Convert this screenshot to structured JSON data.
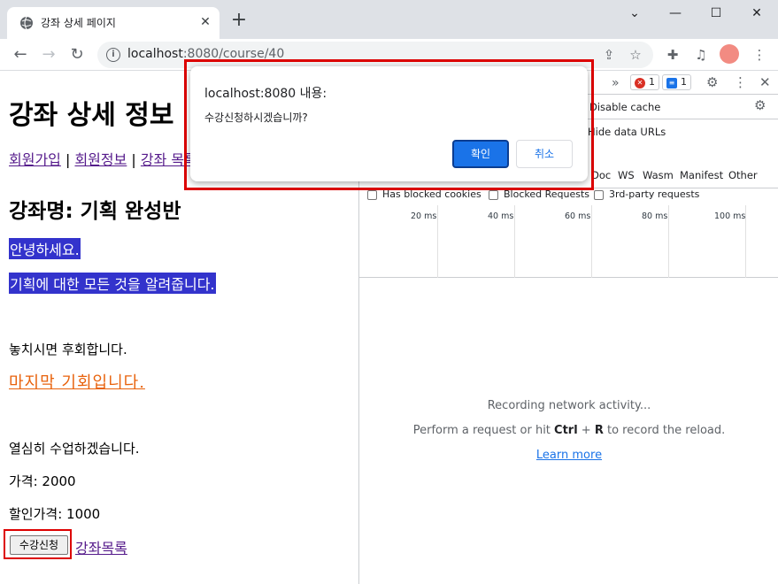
{
  "browser": {
    "tab_title": "강좌 상세 페이지",
    "tab_close": "✕",
    "new_tab": "+",
    "url_host": "localhost",
    "url_path": ":8080/course/40",
    "window_controls": {
      "minimize": "—",
      "maximize": "☐",
      "close": "✕",
      "menu": "⌄"
    }
  },
  "page": {
    "heading": "강좌 상세 정보",
    "nav": {
      "signup": "회원가입",
      "sep1": " | ",
      "info": "회원정보",
      "sep2": " | ",
      "course": "강좌 목록"
    },
    "course_title": "강좌명: 기획 완성반",
    "greeting": "안녕하세요.",
    "intro": "기획에 대한 모든 것을 알려줍니다.",
    "dont_miss": "놓치시면 후회합니다.",
    "last_chance": "마지막 기회입니다.",
    "promise": "열심히 수업하겠습니다.",
    "price": "가격: 2000",
    "sale_price": "할인가격: 1000",
    "enroll_button": "수강신청",
    "list_link": "강좌목록"
  },
  "devtools": {
    "more": "»",
    "error_count": "1",
    "message_count": "1",
    "disable_cache": "Disable cache",
    "hide_data_urls": "Hide data URLs",
    "filters": [
      "Doc",
      "WS",
      "Wasm",
      "Manifest",
      "Other"
    ],
    "has_blocked_cookies": "Has blocked cookies",
    "blocked_requests": "Blocked Requests",
    "third_party": "3rd-party requests",
    "timeline_ticks": [
      "20 ms",
      "40 ms",
      "60 ms",
      "80 ms",
      "100 ms"
    ],
    "recording": "Recording network activity...",
    "perform_prefix": "Perform a request or hit ",
    "perform_ctrl": "Ctrl",
    "perform_plus": " + ",
    "perform_r": "R",
    "perform_suffix": " to record the reload.",
    "learn_more": "Learn more"
  },
  "dialog": {
    "title": "localhost:8080 내용:",
    "message": "수강신청하시겠습니까?",
    "ok": "확인",
    "cancel": "취소"
  },
  "colors": {
    "accent": "#1a73e8",
    "highlight": "#3333cc",
    "annotation": "#dd0000",
    "orange_link": "#e8620c"
  }
}
